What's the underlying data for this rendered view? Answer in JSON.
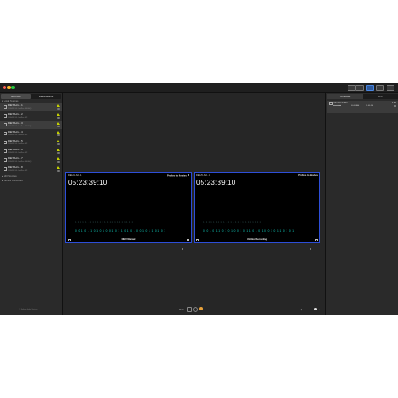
{
  "toolbar": {
    "active_button": "viewer-layout"
  },
  "left_panel": {
    "tabs": [
      "Sources",
      "Destinations"
    ],
    "sections": {
      "local": "Local Sources",
      "ndi": "NDI Sources",
      "remote": "Remote Controlled"
    },
    "sources": [
      {
        "name": "DELTA-hd - 1",
        "sub": "1080i59.94 - ProRes 4444HQ",
        "selected": true
      },
      {
        "name": "DELTA-hd - 2",
        "sub": "1080i59.94 - ProRes 422",
        "selected": false
      },
      {
        "name": "DELTA-hd - 3",
        "sub": "1080i59.94 - ProRes 4444HQ",
        "selected": true
      },
      {
        "name": "DELTA-hd - 4",
        "sub": "1080i59.94 - ProRes 422",
        "selected": false
      },
      {
        "name": "DELTA-hd - 5",
        "sub": "1080i59.94 - ProRes 422",
        "selected": false
      },
      {
        "name": "DELTA-hd - 6",
        "sub": "1080i59.94 - ProRes 422",
        "selected": false
      },
      {
        "name": "DELTA-hd - 7",
        "sub": "1080i59.94 - ProRes 4444HQ",
        "selected": false
      },
      {
        "name": "DELTA-hd - 8",
        "sub": "1080i59.94 - ProRes 422",
        "selected": false
      }
    ],
    "footer": "© Softron Media Services"
  },
  "viewers": [
    {
      "name": "DELTA-hd - 1",
      "format": "ProRes to Movies",
      "timecode": "05:23:39:10",
      "dim_bits": "1 1 1 1 1 1 1 1 1 1 1 1 1 1 1 1 1 1 1 1 1 1 1 1",
      "bits": "0 0 1 0 1 1 0 1 0 1 0 0 1 0 1 1 0 1 0 1 0 0 1 0 1 1 0 1 0 1",
      "label": "NEW Manual"
    },
    {
      "name": "DELTA-hd - 3",
      "format": "ProRes to Movies",
      "timecode": "05:23:39:10",
      "dim_bits": "1 1 1 1 1 1 1 1 1 1 1 1 1 1 1 1 1 1 1 1 1 1 1 1",
      "bits": "0 0 1 0 1 1 0 1 0 1 0 0 1 0 1 1 0 1 0 1 0 0 1 0 1 1 0 1 0 1",
      "label": "Untitled Recording"
    }
  ],
  "bottom_bar": {
    "rec_label": "REC"
  },
  "right_panel": {
    "tabs": [
      "Schedule",
      "LTC"
    ],
    "schedule": {
      "title": "Scheduled Rec",
      "right_top": "1:00",
      "date": "●●●●●●●●",
      "time1": "00:00 AM",
      "time2": "1:00 AM"
    }
  },
  "colors": {
    "viewer_border": "#2d4ed8",
    "bits": "#11d4c4",
    "warning": "#c8d400",
    "rec": "#e8a23a"
  }
}
